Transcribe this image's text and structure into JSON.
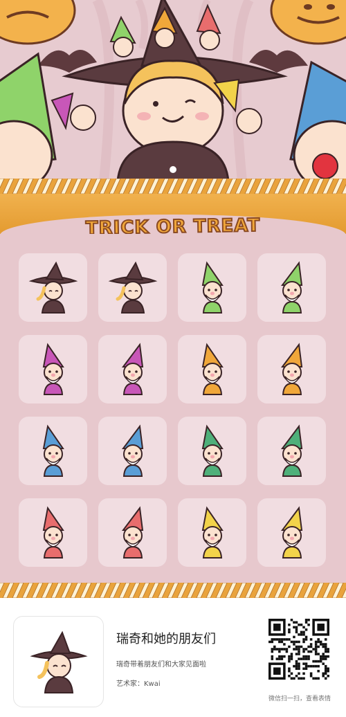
{
  "title": "TRICK OR TREAT",
  "stickers": [
    {
      "label": "witch-sticker-1",
      "hat": "#5a3b3f",
      "body": "#5a3b3f",
      "hair": "#f4c25c"
    },
    {
      "label": "witch-sticker-2",
      "hat": "#5a3b3f",
      "body": "#5a3b3f",
      "hair": "#f4c25c"
    },
    {
      "label": "green-gnome-sticker-1",
      "hat": "#8fd36a",
      "body": "#8fd36a"
    },
    {
      "label": "green-gnome-sticker-2",
      "hat": "#8fd36a",
      "body": "#8fd36a"
    },
    {
      "label": "pink-gnome-sticker-1",
      "hat": "#c857b8",
      "body": "#c857b8"
    },
    {
      "label": "pink-gnome-sticker-2",
      "hat": "#c857b8",
      "body": "#c857b8"
    },
    {
      "label": "orange-gnome-sticker-1",
      "hat": "#f0a73a",
      "body": "#f0a73a"
    },
    {
      "label": "orange-gnome-sticker-2",
      "hat": "#f0a73a",
      "body": "#f0a73a"
    },
    {
      "label": "blue-gnome-sticker-1",
      "hat": "#5a9ed6",
      "body": "#5a9ed6"
    },
    {
      "label": "blue-gnome-sticker-2",
      "hat": "#5a9ed6",
      "body": "#5a9ed6"
    },
    {
      "label": "green-gnome-sticker-3",
      "hat": "#4fb07a",
      "body": "#4fb07a"
    },
    {
      "label": "green-gnome-sticker-4",
      "hat": "#4fb07a",
      "body": "#4fb07a"
    },
    {
      "label": "red-gnome-sticker-1",
      "hat": "#e86d6d",
      "body": "#e86d6d"
    },
    {
      "label": "red-gnome-sticker-2",
      "hat": "#e86d6d",
      "body": "#e86d6d"
    },
    {
      "label": "yellow-gnome-sticker-1",
      "hat": "#f2d34a",
      "body": "#f2d34a"
    },
    {
      "label": "yellow-gnome-sticker-2",
      "hat": "#f2d34a",
      "body": "#f2d34a"
    }
  ],
  "footer": {
    "pack_title": "瑞奇和她的朋友们",
    "pack_desc": "瑞奇带着朋友们和大家见面啦",
    "artist": "艺术家：Kwai",
    "qr_caption": "微信扫一扫，查看表情"
  },
  "colors": {
    "background": "#e7c8cd",
    "tile": "#f1dde1",
    "rope_gold": "#e9a33c",
    "rope_cream": "#fff3d6",
    "title_fill": "#f2a83a",
    "title_stroke": "#8a4a22"
  }
}
